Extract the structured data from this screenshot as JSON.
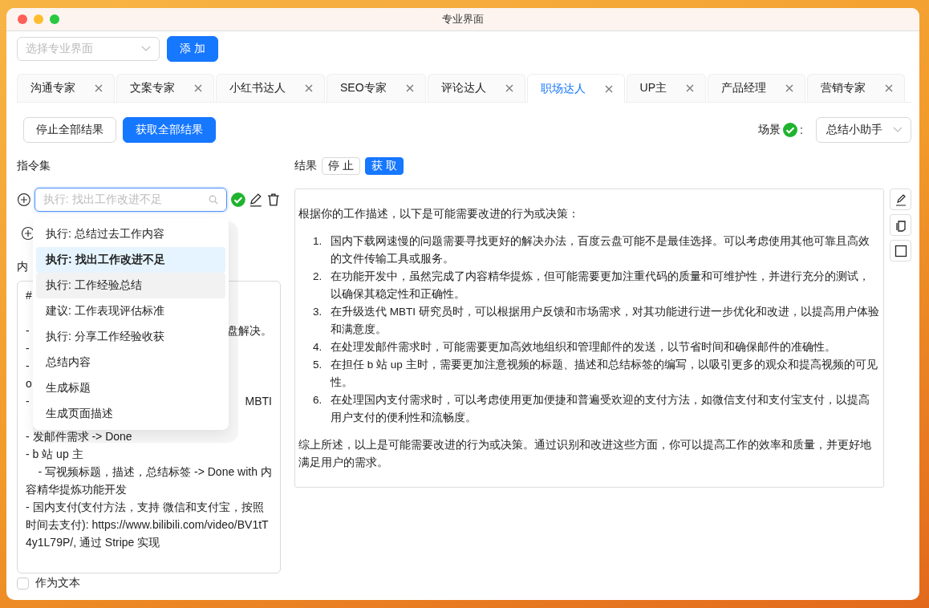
{
  "window": {
    "title": "专业界面"
  },
  "toolbar": {
    "select_placeholder": "选择专业界面",
    "add_button": "添 加"
  },
  "tabs": [
    {
      "label": "沟通专家",
      "selected": false
    },
    {
      "label": "文案专家",
      "selected": false
    },
    {
      "label": "小红书达人",
      "selected": false
    },
    {
      "label": "SEO专家",
      "selected": false
    },
    {
      "label": "评论达人",
      "selected": false
    },
    {
      "label": "职场达人",
      "selected": true
    },
    {
      "label": "UP主",
      "selected": false
    },
    {
      "label": "产品经理",
      "selected": false
    },
    {
      "label": "营销专家",
      "selected": false
    }
  ],
  "actions": {
    "stop_all": "停止全部结果",
    "fetch_all": "获取全部结果",
    "scene_label": "场景",
    "scene_valid": true,
    "scene_colon": ":",
    "scene_value": "总结小助手"
  },
  "instructions": {
    "label": "指令集",
    "search_placeholder": "执行: 找出工作改进不足",
    "content_label": "内",
    "content_lines": [
      {
        "kind": "covered",
        "left": "#"
      },
      {
        "kind": "blank"
      },
      {
        "kind": "covered",
        "left": "-",
        "right": "盘解决。"
      },
      {
        "kind": "covered",
        "left": "-"
      },
      {
        "kind": "covered",
        "left": "-"
      },
      {
        "kind": "covered",
        "left": "o"
      },
      {
        "kind": "covered",
        "left": "-",
        "right": "MBTI"
      },
      {
        "kind": "blank"
      },
      {
        "kind": "text",
        "text": "- 发邮件需求 -> Done"
      },
      {
        "kind": "text",
        "text": "- b 站 up 主"
      },
      {
        "kind": "text",
        "text": "    - 写视频标题，描述，总结标签 -> Done with 内容精华提炼功能开发"
      },
      {
        "kind": "text",
        "text": "- 国内支付(支付方法，支持 微信和支付宝，按照时间去支付): https://www.bilibili.com/video/BV1tT4y1L79P/, 通过 Stripe 实现"
      }
    ],
    "as_text": {
      "label": "作为文本",
      "checked": false
    }
  },
  "dropdown": [
    {
      "label": "执行: 总结过去工作内容",
      "selected": false,
      "hovered": false
    },
    {
      "label": "执行: 找出工作改进不足",
      "selected": true,
      "hovered": false
    },
    {
      "label": "执行: 工作经验总结",
      "selected": false,
      "hovered": true
    },
    {
      "label": "建议: 工作表现评估标准",
      "selected": false,
      "hovered": false
    },
    {
      "label": "执行: 分享工作经验收获",
      "selected": false,
      "hovered": false
    },
    {
      "label": "总结内容",
      "selected": false,
      "hovered": false
    },
    {
      "label": "生成标题",
      "selected": false,
      "hovered": false
    },
    {
      "label": "生成页面描述",
      "selected": false,
      "hovered": false
    }
  ],
  "result": {
    "label": "结果",
    "stop": "停 止",
    "fetch": "获 取",
    "intro": "根据你的工作描述，以下是可能需要改进的行为或决策：",
    "items": [
      {
        "number": "1.",
        "text": "国内下载网速慢的问题需要寻找更好的解决办法，百度云盘可能不是最佳选择。可以考虑使用其他可靠且高效的文件传输工具或服务。"
      },
      {
        "number": "2.",
        "text": "在功能开发中，虽然完成了内容精华提炼，但可能需要更加注重代码的质量和可维护性，并进行充分的测试，以确保其稳定性和正确性。"
      },
      {
        "number": "3.",
        "text": "在升级迭代 MBTI 研究员时，可以根据用户反馈和市场需求，对其功能进行进一步优化和改进，以提高用户体验和满意度。"
      },
      {
        "number": "4.",
        "text": "在处理发邮件需求时，可能需要更加高效地组织和管理邮件的发送，以节省时间和确保邮件的准确性。"
      },
      {
        "number": "5.",
        "text": "在担任 b 站 up 主时，需要更加注意视频的标题、描述和总结标签的编写，以吸引更多的观众和提高视频的可见性。"
      },
      {
        "number": "6.",
        "text": "在处理国内支付需求时，可以考虑使用更加便捷和普遍受欢迎的支付方法，如微信支付和支付宝支付，以提高用户支付的便利性和流畅度。"
      }
    ],
    "summary": "综上所述，以上是可能需要改进的行为或决策。通过识别和改进这些方面，你可以提高工作的效率和质量，并更好地满足用户的需求。"
  }
}
